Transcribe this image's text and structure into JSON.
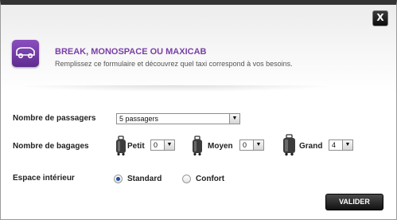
{
  "dialog": {
    "close_label": "X",
    "title": "BREAK, MONOSPACE OU MAXICAB",
    "subtitle": "Remplissez ce formulaire et découvrez quel taxi correspond à vos besoins.",
    "icon": "minivan-icon",
    "accent_color": "#7a3fa6"
  },
  "passengers": {
    "label": "Nombre de passagers",
    "selected": "5 passagers"
  },
  "luggage": {
    "label": "Nombre de bagages",
    "items": [
      {
        "label": "Petit",
        "value": "0",
        "icon": "suitcase-icon"
      },
      {
        "label": "Moyen",
        "value": "0",
        "icon": "suitcase-icon"
      },
      {
        "label": "Grand",
        "value": "4",
        "icon": "suitcase-icon"
      }
    ]
  },
  "interior": {
    "label": "Espace intérieur",
    "options": [
      {
        "label": "Standard",
        "checked": true
      },
      {
        "label": "Confort",
        "checked": false
      }
    ]
  },
  "submit_label": "VALIDER"
}
